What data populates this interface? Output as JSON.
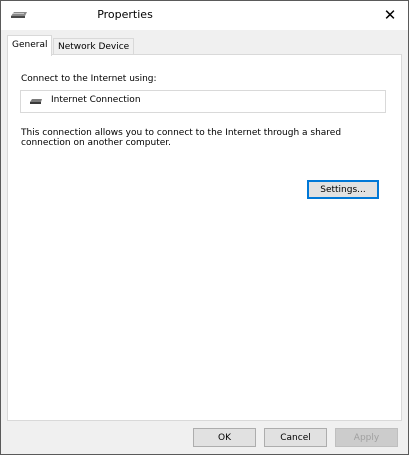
{
  "window": {
    "title": "Properties",
    "close_glyph": "✕"
  },
  "tabs": [
    {
      "label": "General",
      "active": true
    },
    {
      "label": "Network Device",
      "active": false
    }
  ],
  "general": {
    "connect_label": "Connect to the Internet using:",
    "device_icon": "network-adapter-icon",
    "device_name": "Internet Connection",
    "description": "This connection allows you to connect to the Internet through a shared connection on another computer.",
    "settings_label": "Settings..."
  },
  "footer": {
    "ok_label": "OK",
    "cancel_label": "Cancel",
    "apply_label": "Apply",
    "apply_enabled": false
  },
  "colors": {
    "focus_accent": "#0078d7",
    "panel_border": "#d9d9d9",
    "window_bg": "#f0f0f0"
  }
}
